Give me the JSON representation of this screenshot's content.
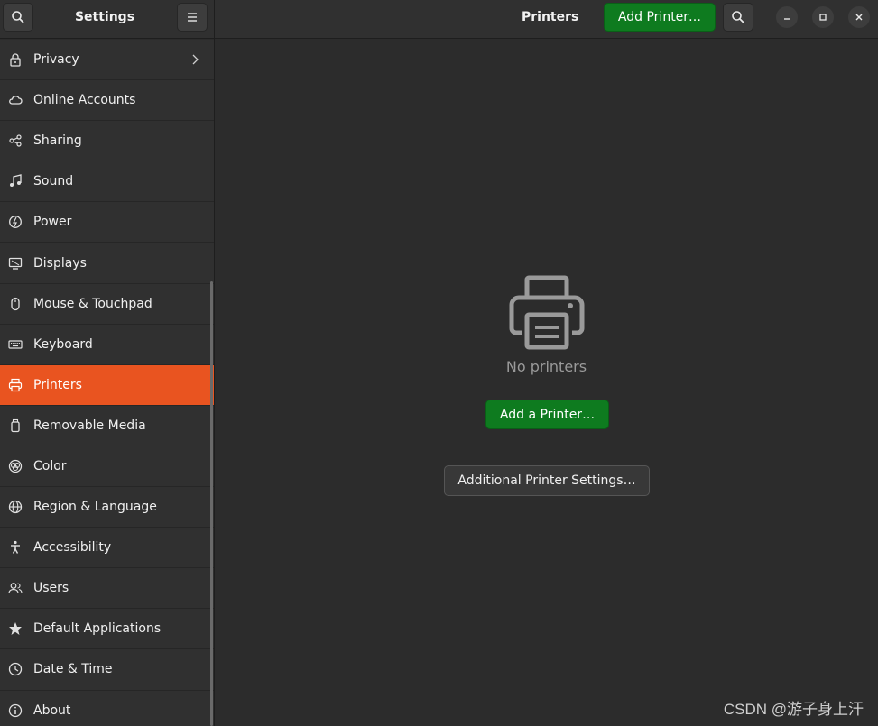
{
  "sidebar_header": {
    "title": "Settings",
    "search_icon": "search-icon",
    "menu_icon": "hamburger-menu-icon"
  },
  "main_header": {
    "title": "Printers",
    "add_printer_label": "Add Printer…"
  },
  "sidebar": {
    "active": "Printers",
    "items": [
      {
        "label": "Privacy",
        "icon": "lock-icon",
        "has_chevron": true
      },
      {
        "label": "Online Accounts",
        "icon": "cloud-icon"
      },
      {
        "label": "Sharing",
        "icon": "share-icon"
      },
      {
        "label": "Sound",
        "icon": "music-note-icon"
      },
      {
        "label": "Power",
        "icon": "power-icon"
      },
      {
        "label": "Displays",
        "icon": "display-icon"
      },
      {
        "label": "Mouse & Touchpad",
        "icon": "mouse-icon"
      },
      {
        "label": "Keyboard",
        "icon": "keyboard-icon"
      },
      {
        "label": "Printers",
        "icon": "printer-icon"
      },
      {
        "label": "Removable Media",
        "icon": "removable-media-icon"
      },
      {
        "label": "Color",
        "icon": "color-icon"
      },
      {
        "label": "Region & Language",
        "icon": "globe-icon"
      },
      {
        "label": "Accessibility",
        "icon": "accessibility-icon"
      },
      {
        "label": "Users",
        "icon": "users-icon"
      },
      {
        "label": "Default Applications",
        "icon": "star-icon"
      },
      {
        "label": "Date & Time",
        "icon": "clock-icon"
      },
      {
        "label": "About",
        "icon": "info-icon"
      }
    ]
  },
  "main": {
    "empty_text": "No printers",
    "add_a_printer_label": "Add a Printer…",
    "additional_settings_label": "Additional Printer Settings…"
  },
  "watermark": "CSDN @游子身上汗",
  "colors": {
    "accent": "#e95420",
    "green": "#0e7b1f",
    "bg": "#2c2c2c",
    "sidebar_bg": "#303030"
  }
}
